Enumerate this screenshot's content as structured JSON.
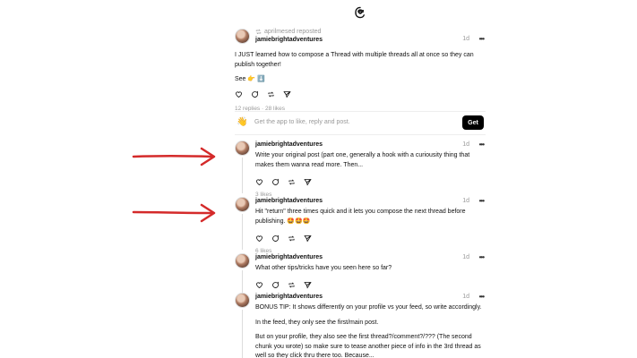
{
  "app": {
    "logo_icon": "threads-logo-icon"
  },
  "posts": [
    {
      "reposted_by": "aprilmesed reposted",
      "username": "jamiebrightadventures",
      "time": "1d",
      "more": "•••",
      "paragraphs": [
        "I JUST learned how to compose a Thread with multiple threads all at once so they can publish together!"
      ],
      "see": "See 👉 ⬇️",
      "stats": "12 replies · 28 likes"
    },
    {
      "username": "jamiebrightadventures",
      "time": "1d",
      "more": "•••",
      "paragraphs": [
        "Write your original post (part one, generally a hook with a curiousity thing that makes them wanna read more. Then..."
      ],
      "stats": "3 likes"
    },
    {
      "username": "jamiebrightadventures",
      "time": "1d",
      "more": "•••",
      "paragraphs": [
        "Hit \"return\" three times quick and it lets you compose the next thread before publishing. 🤩🤩🤩"
      ],
      "stats": "6 likes"
    },
    {
      "username": "jamiebrightadventures",
      "time": "1d",
      "more": "•••",
      "paragraphs": [
        "What other tips/tricks have you seen here so far?"
      ],
      "stats": ""
    },
    {
      "username": "jamiebrightadventures",
      "time": "1d",
      "more": "•••",
      "paragraphs": [
        "BONUS TIP: It shows differently on your profile vs your feed, so write accordingly.",
        "In the feed, they only see the first/main post.",
        "But on your profile, they also see the first thread?/comment?/??? (The second chunk you wrote) so make sure to tease another piece of info in the 3rd thread as well so they click thru there too. Because..."
      ]
    }
  ],
  "get_app": {
    "emoji": "👋",
    "prompt": "Get the app to like, reply and post.",
    "button": "Get"
  },
  "colors": {
    "arrow": "#d42a2a",
    "muted": "#999999",
    "button_bg": "#000000"
  }
}
